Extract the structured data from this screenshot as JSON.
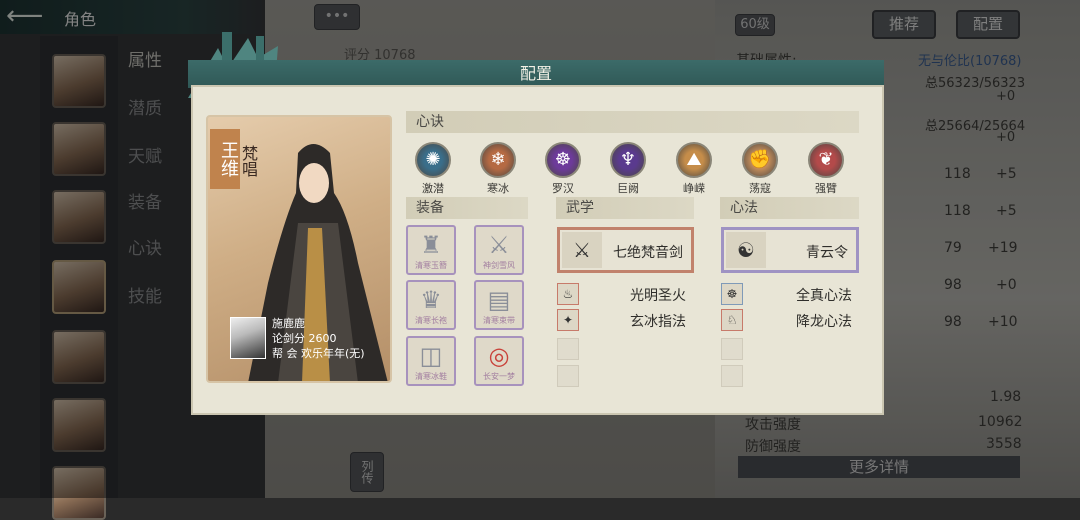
{
  "header": {
    "title": "角色",
    "back_icon": "back-arrow-icon"
  },
  "side_nav": [
    "属性",
    "潜质",
    "天赋",
    "装备",
    "心诀",
    "技能"
  ],
  "background": {
    "chat_dots": "•••",
    "score": "评分 10768",
    "level": "60级",
    "recommend": "推荐",
    "config": "配置",
    "base_attr_label": "基础属性:",
    "base_attr_link": "无与伦比(10768)",
    "hp": "总56323/56323",
    "hp_plus": "+0",
    "mp": "总25664/25664",
    "mp_plus": "+0",
    "stats": [
      {
        "value": "118",
        "plus": "+5"
      },
      {
        "value": "118",
        "plus": "+5"
      },
      {
        "value": "79",
        "plus": "+19"
      },
      {
        "value": "98",
        "plus": "+0"
      },
      {
        "value": "98",
        "plus": "+10"
      }
    ],
    "stat_rows": [
      {
        "label": "",
        "value": "1.98"
      },
      {
        "label": "攻击强度",
        "value": "10962"
      },
      {
        "label": "防御强度",
        "value": "3558"
      }
    ],
    "more_details": "更多详情",
    "bottom_tab": "列传"
  },
  "panel": {
    "title": "配置",
    "character": {
      "name": "王维",
      "school": "梵唱",
      "player": "施鹿鹿",
      "pvp_score": "论剑分 2600",
      "guild": "帮    会 欢乐年年(无)"
    },
    "xinjue": {
      "label": "心诀",
      "items": [
        {
          "name": "激潜",
          "color": "#3a6e8a",
          "icon": "swirl-icon"
        },
        {
          "name": "寒冰",
          "color": "#b56a43",
          "icon": "snowflake-icon"
        },
        {
          "name": "罗汉",
          "color": "#6d3b9a",
          "icon": "monk-icon"
        },
        {
          "name": "巨阙",
          "color": "#5a3a8e",
          "icon": "sword-gate-icon"
        },
        {
          "name": "峥嵘",
          "color": "#c58d4a",
          "icon": "mountain-icon"
        },
        {
          "name": "荡寇",
          "color": "#c08b5a",
          "icon": "fist-icon"
        },
        {
          "name": "强臂",
          "color": "#b34a4a",
          "icon": "arm-icon"
        }
      ]
    },
    "equipment": {
      "label": "装备",
      "items": [
        {
          "name": "清寒玉簪",
          "glyph": "♜"
        },
        {
          "name": "神剑雪风",
          "glyph": "⚔"
        },
        {
          "name": "清寒长袍",
          "glyph": "♛"
        },
        {
          "name": "清寒束带",
          "glyph": "▤"
        },
        {
          "name": "清寒冰鞋",
          "glyph": "◫"
        },
        {
          "name": "长安一梦",
          "glyph": "◎"
        }
      ]
    },
    "martial": {
      "label": "武学",
      "main": "七绝梵音剑",
      "subs": [
        "光明圣火",
        "玄冰指法"
      ]
    },
    "mind": {
      "label": "心法",
      "main": "青云令",
      "subs": [
        "全真心法",
        "降龙心法"
      ]
    }
  }
}
